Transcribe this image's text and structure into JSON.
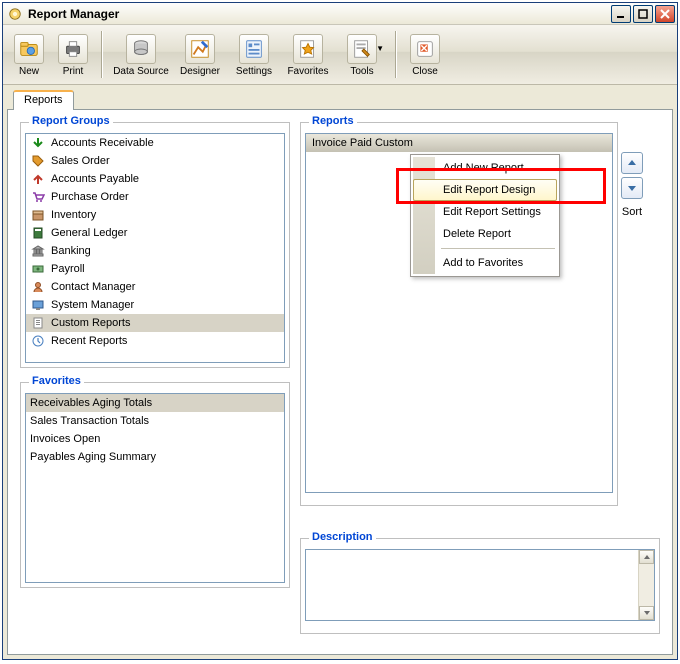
{
  "window": {
    "title": "Report Manager"
  },
  "toolbar": {
    "new": "New",
    "print": "Print",
    "datasource": "Data Source",
    "designer": "Designer",
    "settings": "Settings",
    "favorites": "Favorites",
    "tools": "Tools",
    "close": "Close"
  },
  "tabs": {
    "reports": "Reports"
  },
  "groups": {
    "reportGroups": "Report Groups",
    "favorites": "Favorites",
    "reports": "Reports",
    "description": "Description"
  },
  "reportGroups": [
    {
      "label": "Accounts Receivable"
    },
    {
      "label": "Sales Order"
    },
    {
      "label": "Accounts Payable"
    },
    {
      "label": "Purchase Order"
    },
    {
      "label": "Inventory"
    },
    {
      "label": "General Ledger"
    },
    {
      "label": "Banking"
    },
    {
      "label": "Payroll"
    },
    {
      "label": "Contact Manager"
    },
    {
      "label": "System Manager"
    },
    {
      "label": "Custom Reports"
    },
    {
      "label": "Recent Reports"
    }
  ],
  "favorites": [
    "Receivables Aging Totals",
    "Sales Transaction Totals",
    "Invoices Open",
    "Payables Aging Summary"
  ],
  "reports": {
    "header": "Invoice Paid Custom"
  },
  "contextMenu": {
    "addNew": "Add New Report",
    "editDesign": "Edit Report Design",
    "editSettings": "Edit Report Settings",
    "delete": "Delete Report",
    "addFav": "Add to Favorites"
  },
  "sort": {
    "label": "Sort"
  }
}
